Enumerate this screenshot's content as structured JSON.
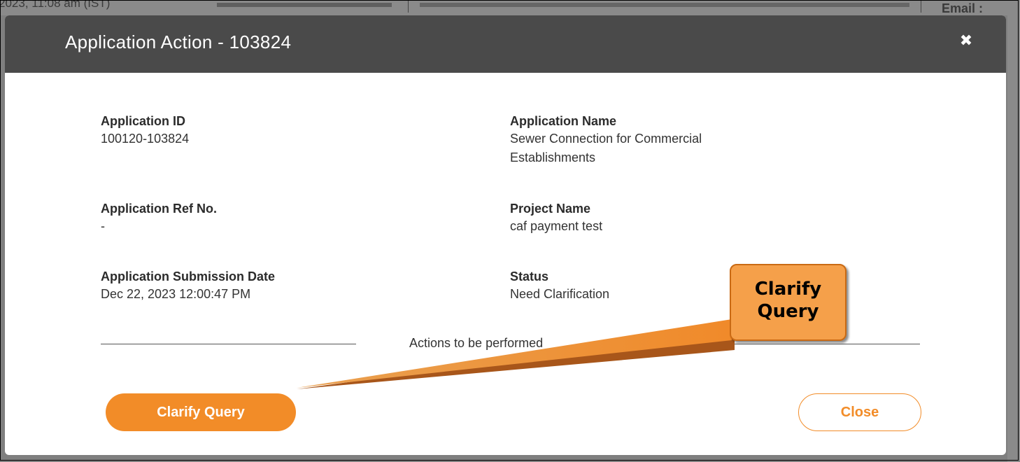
{
  "background": {
    "timestamp": "2023, 11:08 am (IST)",
    "email_label": "Email :"
  },
  "modal": {
    "title": "Application Action - 103824",
    "close_icon": "close-icon",
    "fields": {
      "application_id": {
        "label": "Application ID",
        "value": "100120-103824"
      },
      "application_name": {
        "label": "Application Name",
        "value_line1": "Sewer Connection for Commercial",
        "value_line2": "Establishments"
      },
      "application_ref_no": {
        "label": "Application Ref No.",
        "value": "-"
      },
      "project_name": {
        "label": "Project Name",
        "value": "caf payment test"
      },
      "submission_date": {
        "label": "Application Submission Date",
        "value": "Dec 22, 2023 12:00:47 PM"
      },
      "status": {
        "label": "Status",
        "value": "Need Clarification"
      }
    },
    "actions_label": "Actions to be performed",
    "buttons": {
      "clarify_query": "Clarify Query",
      "close": "Close"
    }
  },
  "annotation": {
    "line1": "Clarify",
    "line2": "Query"
  },
  "colors": {
    "accent": "#f28c28",
    "header_bg": "#4a4a4a",
    "callout_bg": "#f5a04a"
  }
}
